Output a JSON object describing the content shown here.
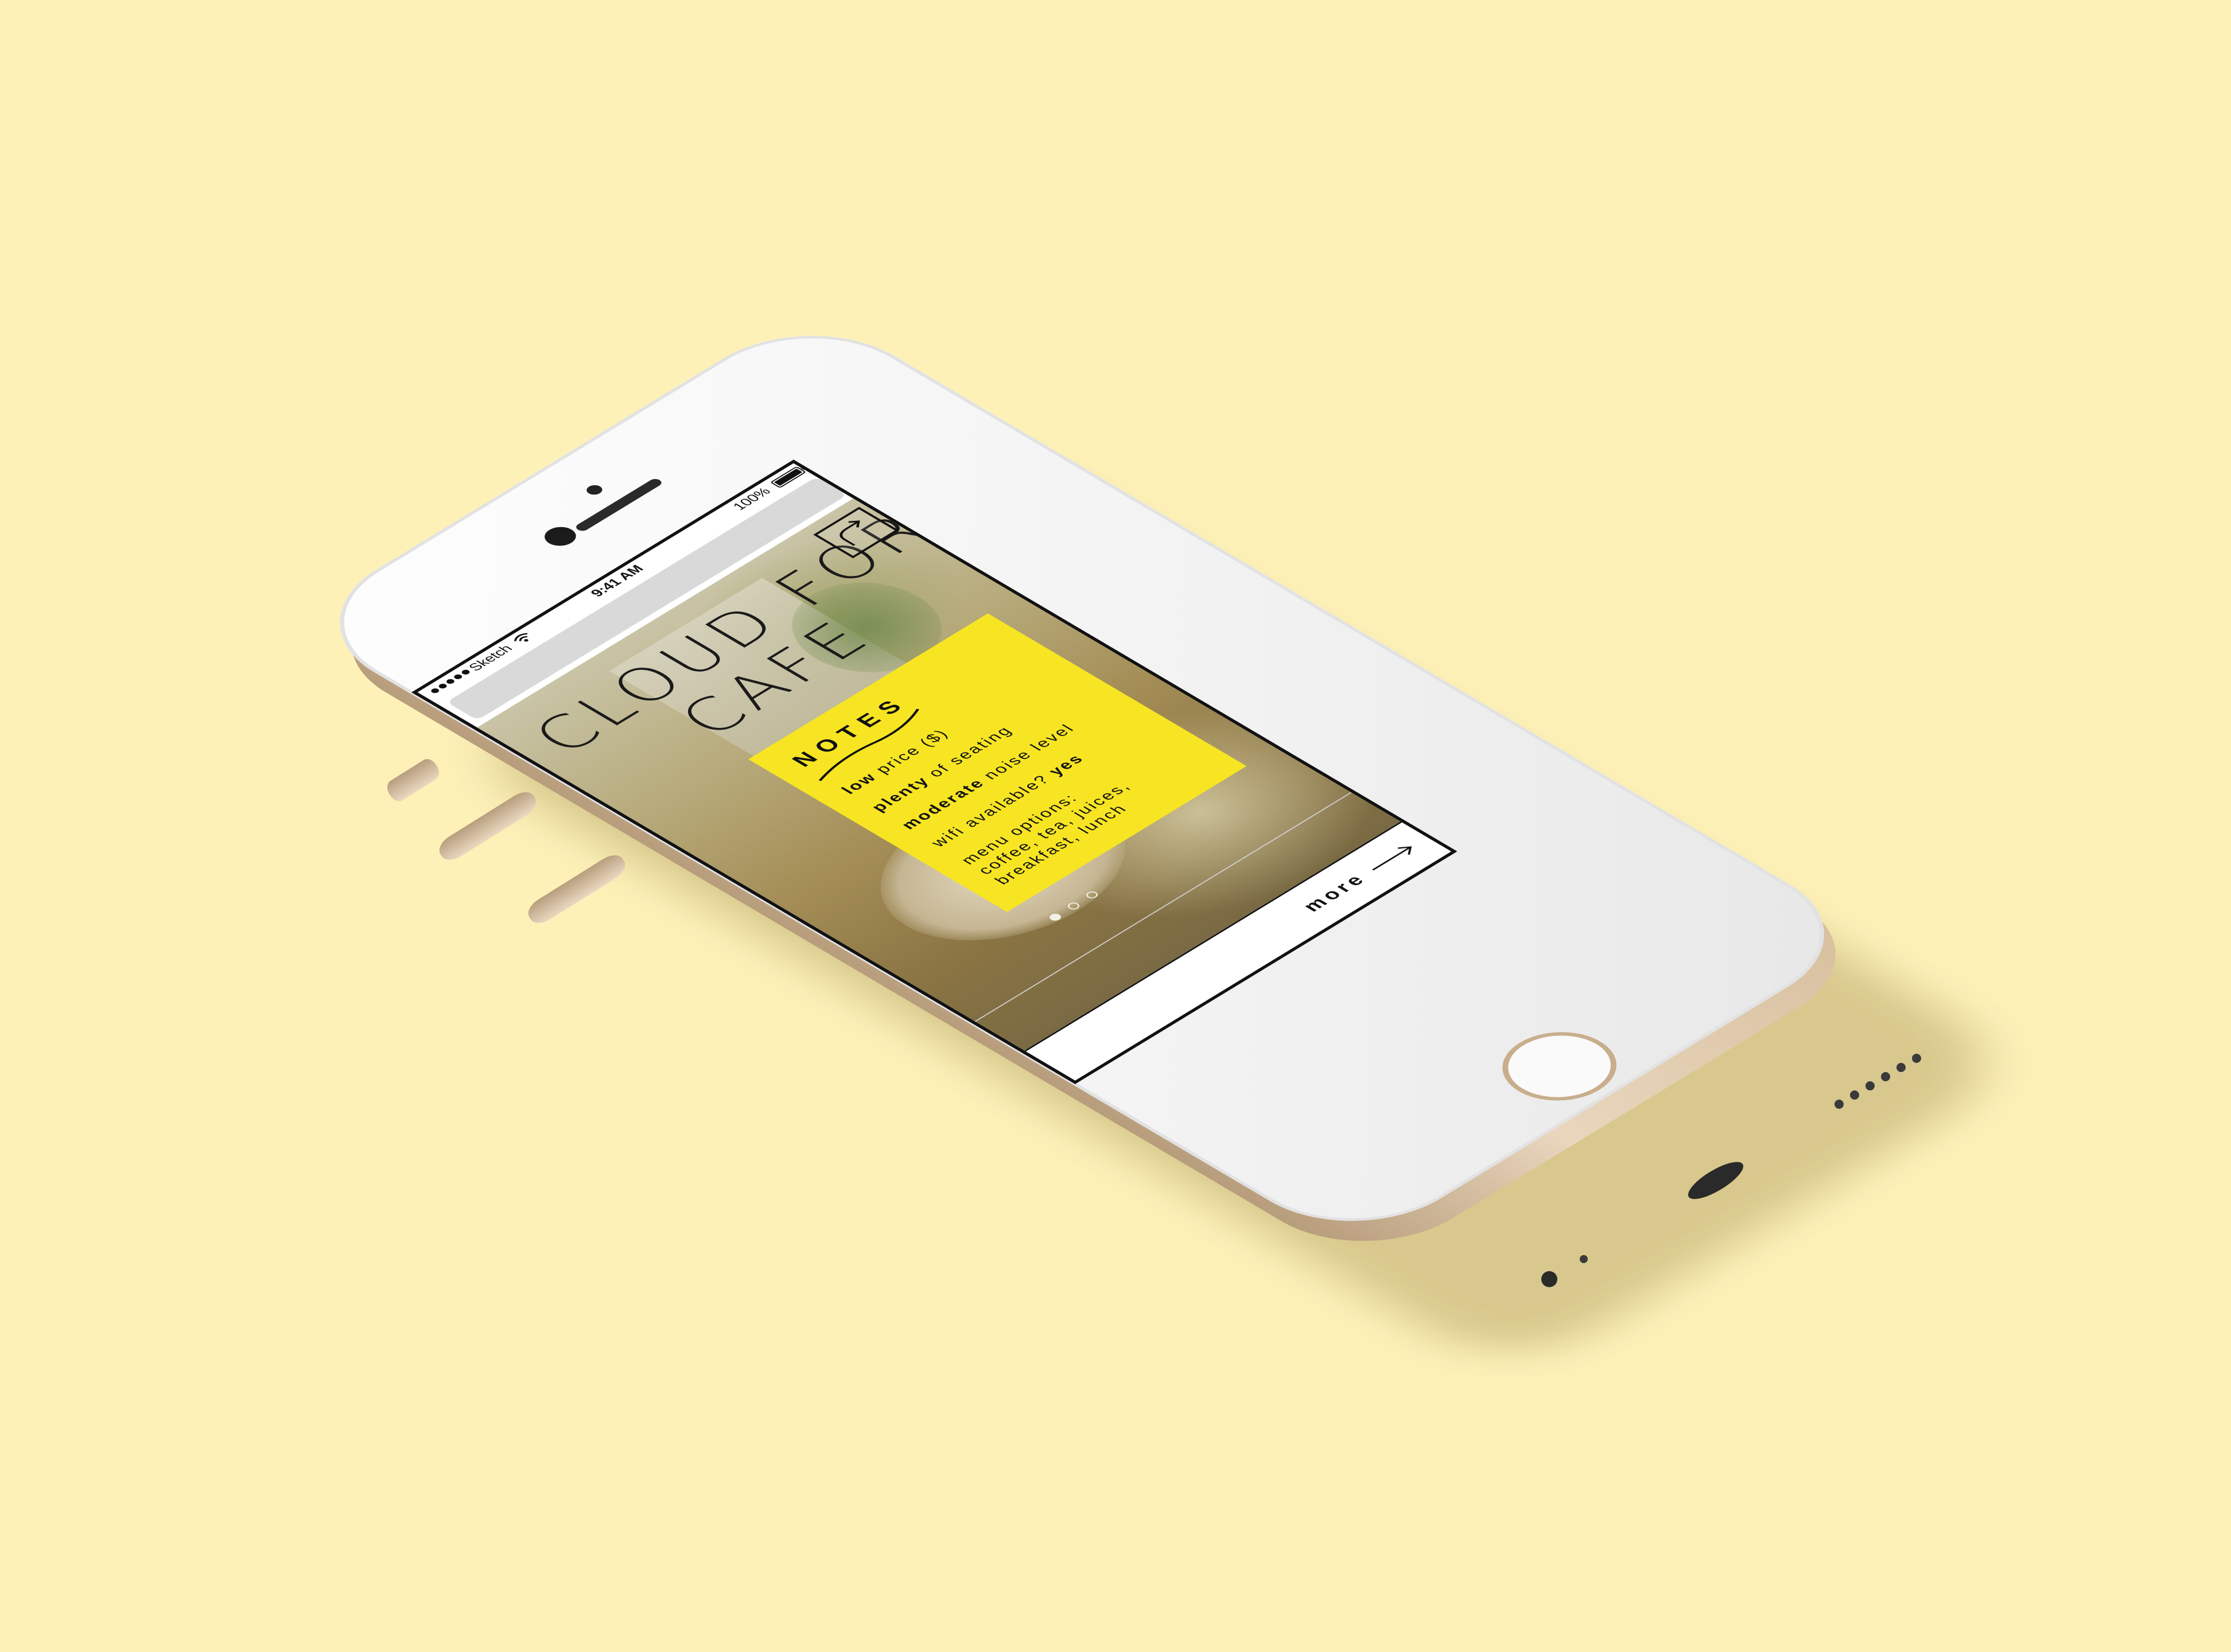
{
  "status_bar": {
    "carrier": "Sketch",
    "time": "9:41 AM",
    "battery": "100%",
    "battery_level": 1.0
  },
  "site": {
    "title_line1": "CLOUD FOREST",
    "title_line2": "CAFE",
    "menu_icon": "redo-arrow-icon"
  },
  "notes": {
    "heading": "NOTES",
    "price_bold": "low",
    "price_rest": " price ($)",
    "seating_bold": "plenty",
    "seating_rest": " of seating",
    "noise_bold": "moderate",
    "noise_rest": " noise level",
    "wifi_label": "wifi available? ",
    "wifi_value": "yes",
    "menu_label": "menu options:",
    "menu_items_line1": "coffee, tea, juices,",
    "menu_items_line2": "breakfast, lunch"
  },
  "carousel": {
    "count": 3,
    "active_index": 0
  },
  "more": {
    "label": "more",
    "icon": "right-arrow-icon"
  },
  "colors": {
    "background": "#fdf1b8",
    "notes_card": "#f7e523",
    "phone_frame": "#e9d6bd"
  }
}
